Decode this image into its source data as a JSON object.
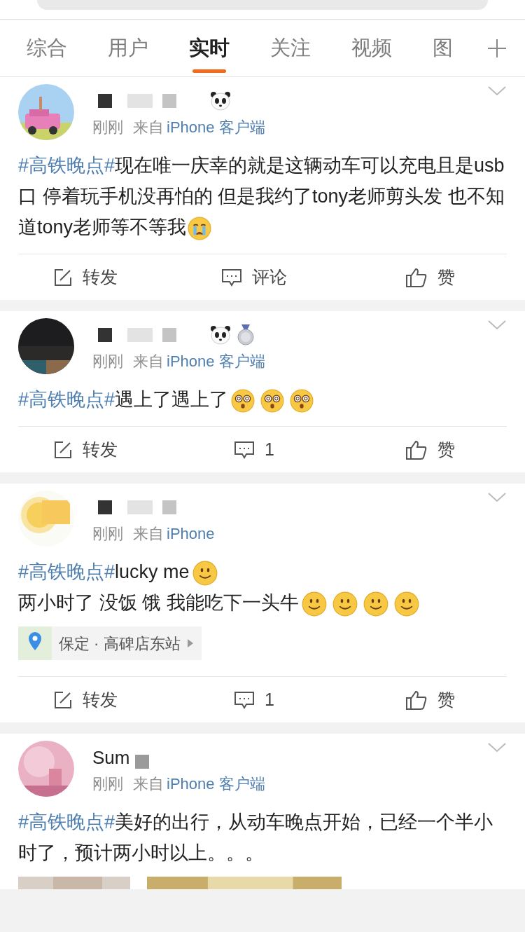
{
  "tabs": [
    {
      "label": "综合",
      "selected": false
    },
    {
      "label": "用户",
      "selected": false
    },
    {
      "label": "实时",
      "selected": true
    },
    {
      "label": "关注",
      "selected": false
    },
    {
      "label": "视频",
      "selected": false
    },
    {
      "label": "图",
      "selected": false
    }
  ],
  "posts": [
    {
      "avatar": {
        "kind": "picture"
      },
      "badges": [
        {
          "kind": "panda"
        }
      ],
      "time": "刚刚",
      "via": "来自",
      "source": "iPhone 客户端",
      "lines": [
        [
          {
            "kind": "topic",
            "text": "#高铁晚点#"
          },
          {
            "kind": "text",
            "text": "现在唯一庆幸的就是这辆动车可以充电且是usb口 停着玩手机没再怕的 但是我约了tony老师剪头发  也不知道tony老师等不等我"
          },
          {
            "kind": "crying"
          }
        ]
      ],
      "actions": [
        {
          "kind": "repost",
          "label": "转发"
        },
        {
          "kind": "comment",
          "label": "评论"
        },
        {
          "kind": "like",
          "label": "赞"
        }
      ]
    },
    {
      "avatar": {
        "kind": "picture"
      },
      "badges": [
        {
          "kind": "panda"
        },
        {
          "kind": "medal"
        }
      ],
      "time": "刚刚",
      "via": "来自",
      "source": "iPhone 客户端",
      "lines": [
        [
          {
            "kind": "topic",
            "text": "#高铁晚点#"
          },
          {
            "kind": "text",
            "text": "遇上了遇上了"
          },
          {
            "kind": "dizzy"
          },
          {
            "kind": "dizzy"
          },
          {
            "kind": "dizzy"
          }
        ]
      ],
      "actions": [
        {
          "kind": "repost",
          "label": "转发"
        },
        {
          "kind": "comment",
          "label": "1"
        },
        {
          "kind": "like",
          "label": "赞"
        }
      ]
    },
    {
      "avatar": {
        "kind": "picture"
      },
      "time": "刚刚",
      "via": "来自",
      "source": "iPhone",
      "lines": [
        [
          {
            "kind": "topic",
            "text": "#高铁晚点#"
          },
          {
            "kind": "text",
            "text": "lucky me"
          },
          {
            "kind": "smile"
          }
        ],
        [
          {
            "kind": "text",
            "text": "两小时了 没饭 饿 我能吃下一头牛"
          },
          {
            "kind": "smile"
          },
          {
            "kind": "smile"
          },
          {
            "kind": "smile"
          },
          {
            "kind": "smile"
          }
        ]
      ],
      "location": "保定 · 高碑店东站",
      "actions": [
        {
          "kind": "repost",
          "label": "转发"
        },
        {
          "kind": "comment",
          "label": "1"
        },
        {
          "kind": "like",
          "label": "赞"
        }
      ]
    },
    {
      "avatar": {
        "kind": "picture"
      },
      "name": "Sum",
      "time": "刚刚",
      "via": "来自",
      "source": "iPhone 客户端",
      "lines": [
        [
          {
            "kind": "topic",
            "text": "#高铁晚点#"
          },
          {
            "kind": "text",
            "text": "美好的出行，从动车晚点开始，已经一个半小时了，预计两小时以上。。。"
          }
        ]
      ],
      "images": [
        {
          "kind": "picture"
        },
        {
          "kind": "picture"
        }
      ]
    }
  ]
}
